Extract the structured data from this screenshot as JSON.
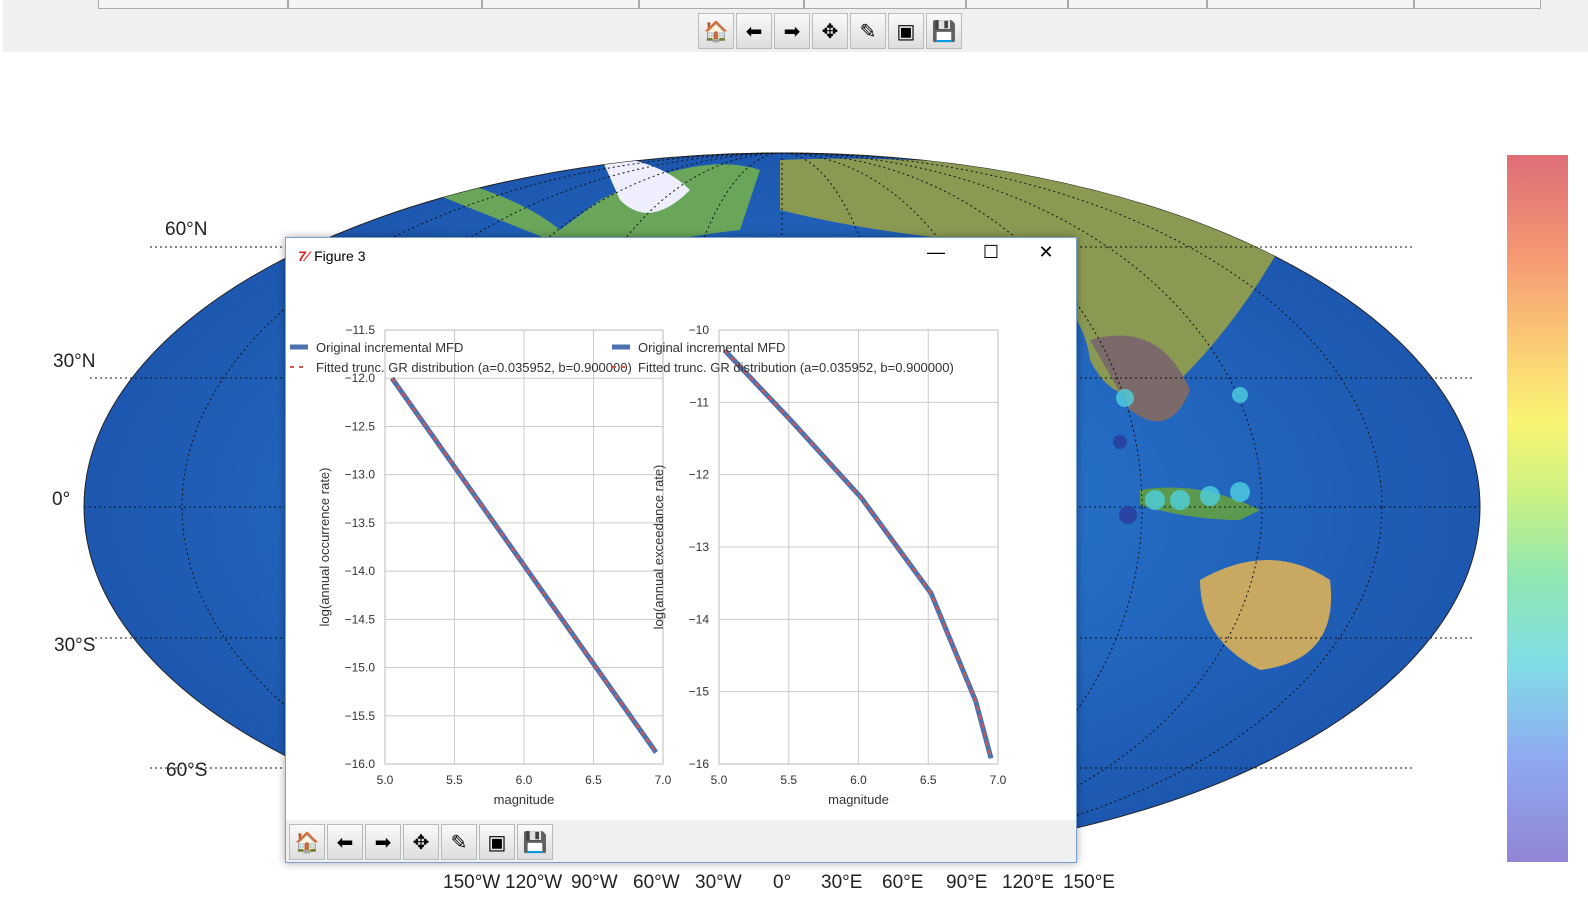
{
  "main_toolbar": {
    "buttons": [
      {
        "name": "home",
        "glyph": "🏠"
      },
      {
        "name": "back",
        "glyph": "⬅"
      },
      {
        "name": "forward",
        "glyph": "➡"
      },
      {
        "name": "pan",
        "glyph": "✥"
      },
      {
        "name": "configure",
        "glyph": "✎"
      },
      {
        "name": "subplots",
        "glyph": "▣"
      },
      {
        "name": "save",
        "glyph": "💾"
      }
    ]
  },
  "map": {
    "lat_labels": [
      "60°N",
      "30°N",
      "0°",
      "30°S",
      "60°S"
    ],
    "lon_labels": [
      "150°W",
      "120°W",
      "90°W",
      "60°W",
      "30°W",
      "0°",
      "30°E",
      "60°E",
      "90°E",
      "120°E",
      "150°E"
    ]
  },
  "figure": {
    "title": "Figure 3",
    "icon": "matplotlib-icon",
    "controls": {
      "minimize": "—",
      "maximize": "☐",
      "close": "✕"
    },
    "toolbar": {
      "buttons": [
        {
          "name": "home",
          "glyph": "🏠"
        },
        {
          "name": "back",
          "glyph": "⬅"
        },
        {
          "name": "forward",
          "glyph": "➡"
        },
        {
          "name": "pan",
          "glyph": "✥"
        },
        {
          "name": "configure",
          "glyph": "✎"
        },
        {
          "name": "subplots",
          "glyph": "▣"
        },
        {
          "name": "save",
          "glyph": "💾"
        }
      ]
    }
  },
  "colors": {
    "original": "#4c72b0",
    "fitted": "#d9534f"
  },
  "chart_data": [
    {
      "type": "line",
      "xlabel": "magnitude",
      "ylabel": "log(annual occurrence rate)",
      "xlim": [
        5.0,
        7.0
      ],
      "ylim": [
        -16.0,
        -11.5
      ],
      "xticks": [
        "5.0",
        "5.5",
        "6.0",
        "6.5",
        "7.0"
      ],
      "yticks": [
        "−11.5",
        "−12.0",
        "−12.5",
        "−13.0",
        "−13.5",
        "−14.0",
        "−14.5",
        "−15.0",
        "−15.5",
        "−16.0"
      ],
      "ytick_values": [
        -11.5,
        -12.0,
        -12.5,
        -13.0,
        -13.5,
        -14.0,
        -14.5,
        -15.0,
        -15.5,
        -16.0
      ],
      "xtick_values": [
        5.0,
        5.5,
        6.0,
        6.5,
        7.0
      ],
      "legend": [
        "Original incremental MFD",
        "Fitted trunc. GR distribution (a=0.035952, b=0.900000)"
      ],
      "legend_position": "top-left",
      "series": [
        {
          "name": "Original incremental MFD",
          "x": [
            5.05,
            6.95
          ],
          "y": [
            -12.0,
            -15.88
          ]
        },
        {
          "name": "Fitted trunc. GR distribution",
          "x": [
            5.05,
            6.95
          ],
          "y": [
            -12.0,
            -15.88
          ]
        }
      ]
    },
    {
      "type": "line",
      "xlabel": "magnitude",
      "ylabel": "log(annual exceedance rate)",
      "xlim": [
        5.0,
        7.0
      ],
      "ylim": [
        -16,
        -10
      ],
      "xticks": [
        "5.0",
        "5.5",
        "6.0",
        "6.5",
        "7.0"
      ],
      "yticks": [
        "−10",
        "−11",
        "−12",
        "−13",
        "−14",
        "−15",
        "−16"
      ],
      "ytick_values": [
        -10,
        -11,
        -12,
        -13,
        -14,
        -15,
        -16
      ],
      "xtick_values": [
        5.0,
        5.5,
        6.0,
        6.5,
        7.0
      ],
      "legend": [
        "Original incremental MFD",
        "Fitted trunc. GR distribution (a=0.035952, b=0.900000)"
      ],
      "legend_position": "top-left",
      "series": [
        {
          "name": "Original incremental MFD",
          "x": [
            5.04,
            5.52,
            6.02,
            6.52,
            6.84,
            6.95
          ],
          "y": [
            -10.28,
            -11.26,
            -12.32,
            -13.64,
            -15.13,
            -15.92
          ]
        },
        {
          "name": "Fitted trunc. GR distribution",
          "x": [
            5.04,
            5.52,
            6.02,
            6.52,
            6.84,
            6.95
          ],
          "y": [
            -10.28,
            -11.26,
            -12.32,
            -13.64,
            -15.13,
            -15.92
          ]
        }
      ]
    }
  ]
}
